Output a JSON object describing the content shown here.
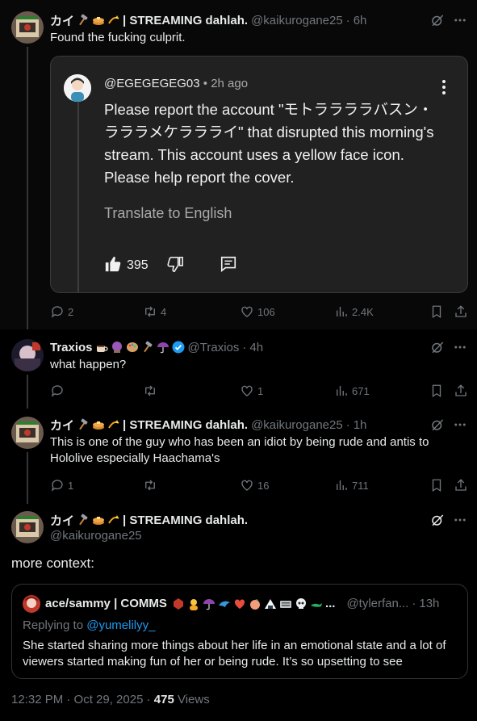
{
  "tweets": [
    {
      "name": "カイ",
      "name_suffix": "| STREAMING dahlah.",
      "handle": "@kaikurogane25",
      "time": "6h",
      "text": "Found the fucking culprit.",
      "replies": "2",
      "retweets": "4",
      "likes": "106",
      "views": "2.4K",
      "embed": {
        "user": "@EGEGEGEG03",
        "time": "2h ago",
        "body": "Please report the account \"モトララララバスン・ラララメケララライ\" that disrupted this morning's stream. This account uses a yellow face icon. Please help report the cover.",
        "translate": "Translate to English",
        "likes": "395"
      }
    },
    {
      "name": "Traxios",
      "handle": "@Traxios",
      "time": "4h",
      "text": "what happen?",
      "replies": "",
      "retweets": "",
      "likes": "1",
      "views": "671"
    },
    {
      "name": "カイ",
      "name_suffix": "| STREAMING dahlah.",
      "handle": "@kaikurogane25",
      "time": "1h",
      "text": "This is one of the guy who has been an idiot by being rude and antis to Hololive especially Haachama's",
      "replies": "1",
      "retweets": "",
      "likes": "16",
      "views": "711"
    }
  ],
  "main": {
    "name": "カイ",
    "name_suffix": "| STREAMING dahlah.",
    "handle": "@kaikurogane25",
    "text": "more context:",
    "quote": {
      "name": "ace/sammy | COMMS",
      "name_tail": "...",
      "handle": "@tylerfan...",
      "time": "13h",
      "replying_prefix": "Replying to",
      "replying_to": "@yumelilyy_",
      "text": "She started sharing more things about her life in an emotional state and a lot of viewers started making fun of her or being rude. It’s so upsetting to see"
    },
    "timestamp": "12:32 PM · Oct 29, 2025 · ",
    "views_count": "475",
    "views_label": " Views"
  },
  "colors": {
    "background": "#000000",
    "text_primary": "#e7e9ea",
    "text_secondary": "#71767b",
    "link": "#1d9bf0",
    "verified": "#1d9bf0",
    "divider": "#333639",
    "yt_card_bg": "#212121"
  },
  "icons": [
    "grok-icon",
    "more-icon",
    "reply-icon",
    "retweet-icon",
    "like-icon",
    "views-icon",
    "bookmark-icon",
    "share-icon",
    "thumbs-up-icon",
    "thumbs-down-icon",
    "comment-icon",
    "verified-badge-icon"
  ]
}
